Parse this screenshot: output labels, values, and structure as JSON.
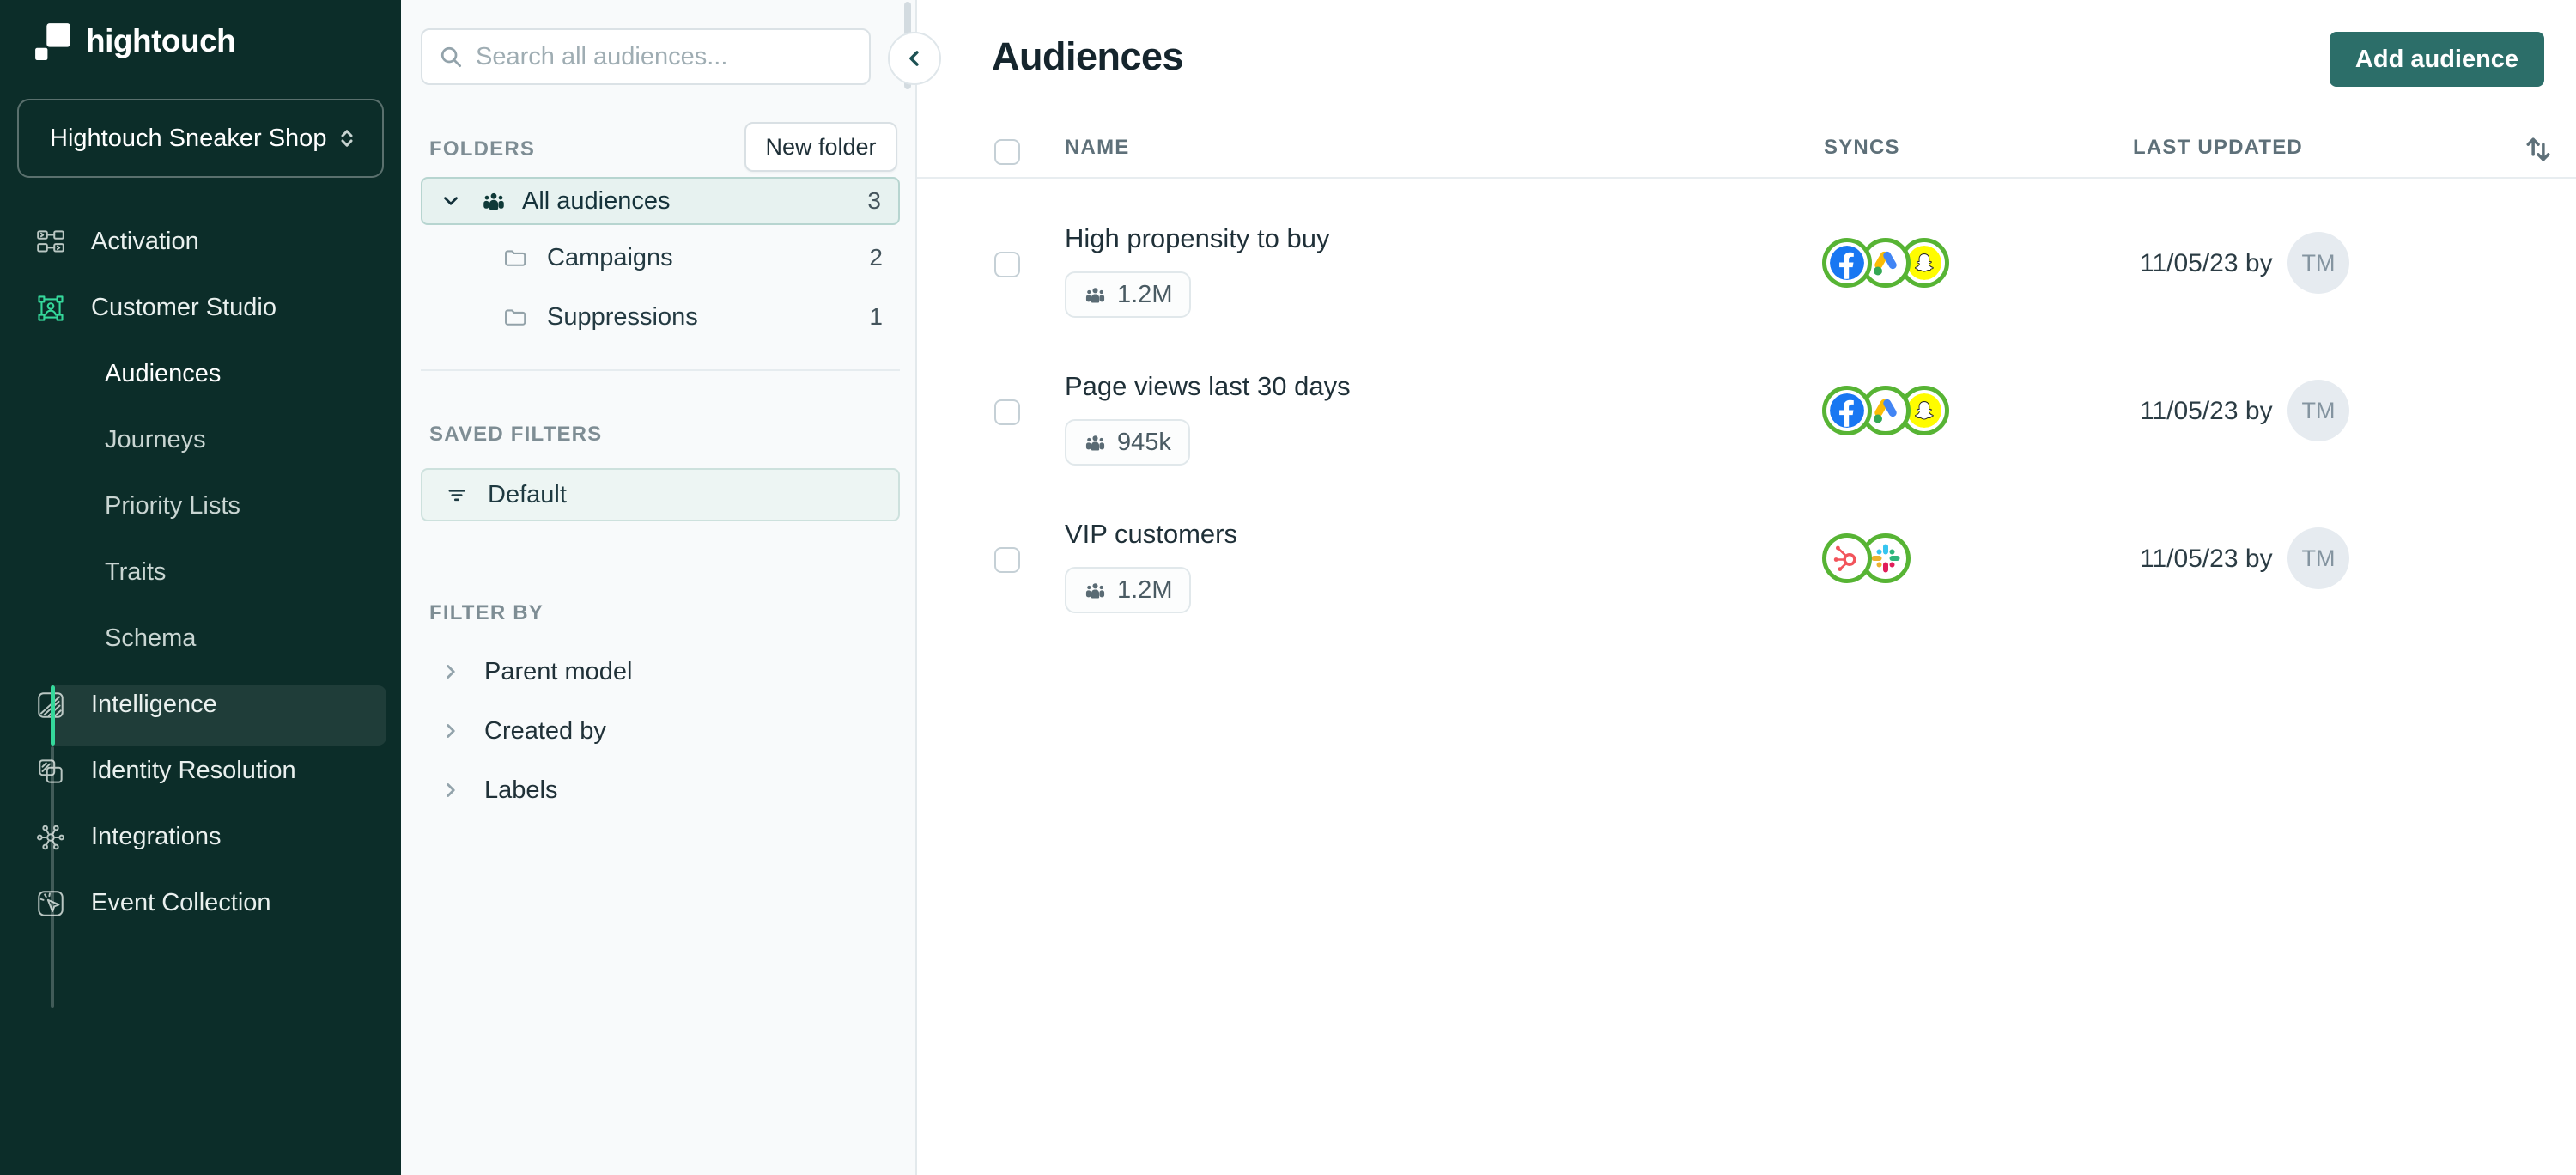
{
  "app": {
    "logo_text": "hightouch",
    "workspace": "Hightouch Sneaker Shop"
  },
  "sidebar": {
    "nav_top": [
      {
        "label": "Activation",
        "icon": "workflow-icon"
      },
      {
        "label": "Customer Studio",
        "icon": "customer-studio-icon"
      }
    ],
    "subnav": {
      "items": [
        "Audiences",
        "Journeys",
        "Priority Lists",
        "Traits",
        "Schema"
      ],
      "selected": "Audiences"
    },
    "nav_bottom": [
      {
        "label": "Intelligence",
        "icon": "intelligence-icon"
      },
      {
        "label": "Identity Resolution",
        "icon": "identity-resolution-icon"
      },
      {
        "label": "Integrations",
        "icon": "integrations-icon"
      },
      {
        "label": "Event Collection",
        "icon": "event-collection-icon"
      }
    ]
  },
  "panel": {
    "search_placeholder": "Search all audiences...",
    "folders": {
      "header": "FOLDERS",
      "new_folder_label": "New folder",
      "items": [
        {
          "label": "All audiences",
          "count": "3",
          "icon": "audience-people-icon",
          "selected": true
        },
        {
          "label": "Campaigns",
          "count": "2",
          "icon": "folder-icon",
          "selected": false
        },
        {
          "label": "Suppressions",
          "count": "1",
          "icon": "folder-icon",
          "selected": false
        }
      ]
    },
    "saved_filters": {
      "header": "SAVED FILTERS",
      "items": [
        {
          "label": "Default",
          "icon": "filter-icon"
        }
      ]
    },
    "filter_by": {
      "header": "FILTER BY",
      "items": [
        "Parent model",
        "Created by",
        "Labels"
      ]
    }
  },
  "main": {
    "title": "Audiences",
    "add_button_label": "Add audience",
    "table": {
      "columns": [
        "NAME",
        "SYNCS",
        "LAST UPDATED"
      ],
      "rows": [
        {
          "name": "High propensity to buy",
          "size": "1.2M",
          "syncs": [
            "facebook",
            "google-ads",
            "snapchat"
          ],
          "updated": "11/05/23 by",
          "avatar": "TM"
        },
        {
          "name": "Page views last 30 days",
          "size": "945k",
          "syncs": [
            "facebook",
            "google-ads",
            "snapchat"
          ],
          "updated": "11/05/23 by",
          "avatar": "TM"
        },
        {
          "name": "VIP customers",
          "size": "1.2M",
          "syncs": [
            "hubspot",
            "slack"
          ],
          "updated": "11/05/23 by",
          "avatar": "TM"
        }
      ]
    }
  },
  "colors": {
    "sidebar_bg": "#0c2d29",
    "accent_green": "#35d89b",
    "sync_ring_green": "#57b434",
    "primary_button": "#2c6e69",
    "selected_folder_bg": "#e7f2f0",
    "selected_folder_border": "#b7d5d0",
    "facebook_blue": "#1877f2",
    "snapchat_yellow": "#fffc00",
    "slack_red": "#e01e5a",
    "hubspot_orange": "#f2545b"
  }
}
